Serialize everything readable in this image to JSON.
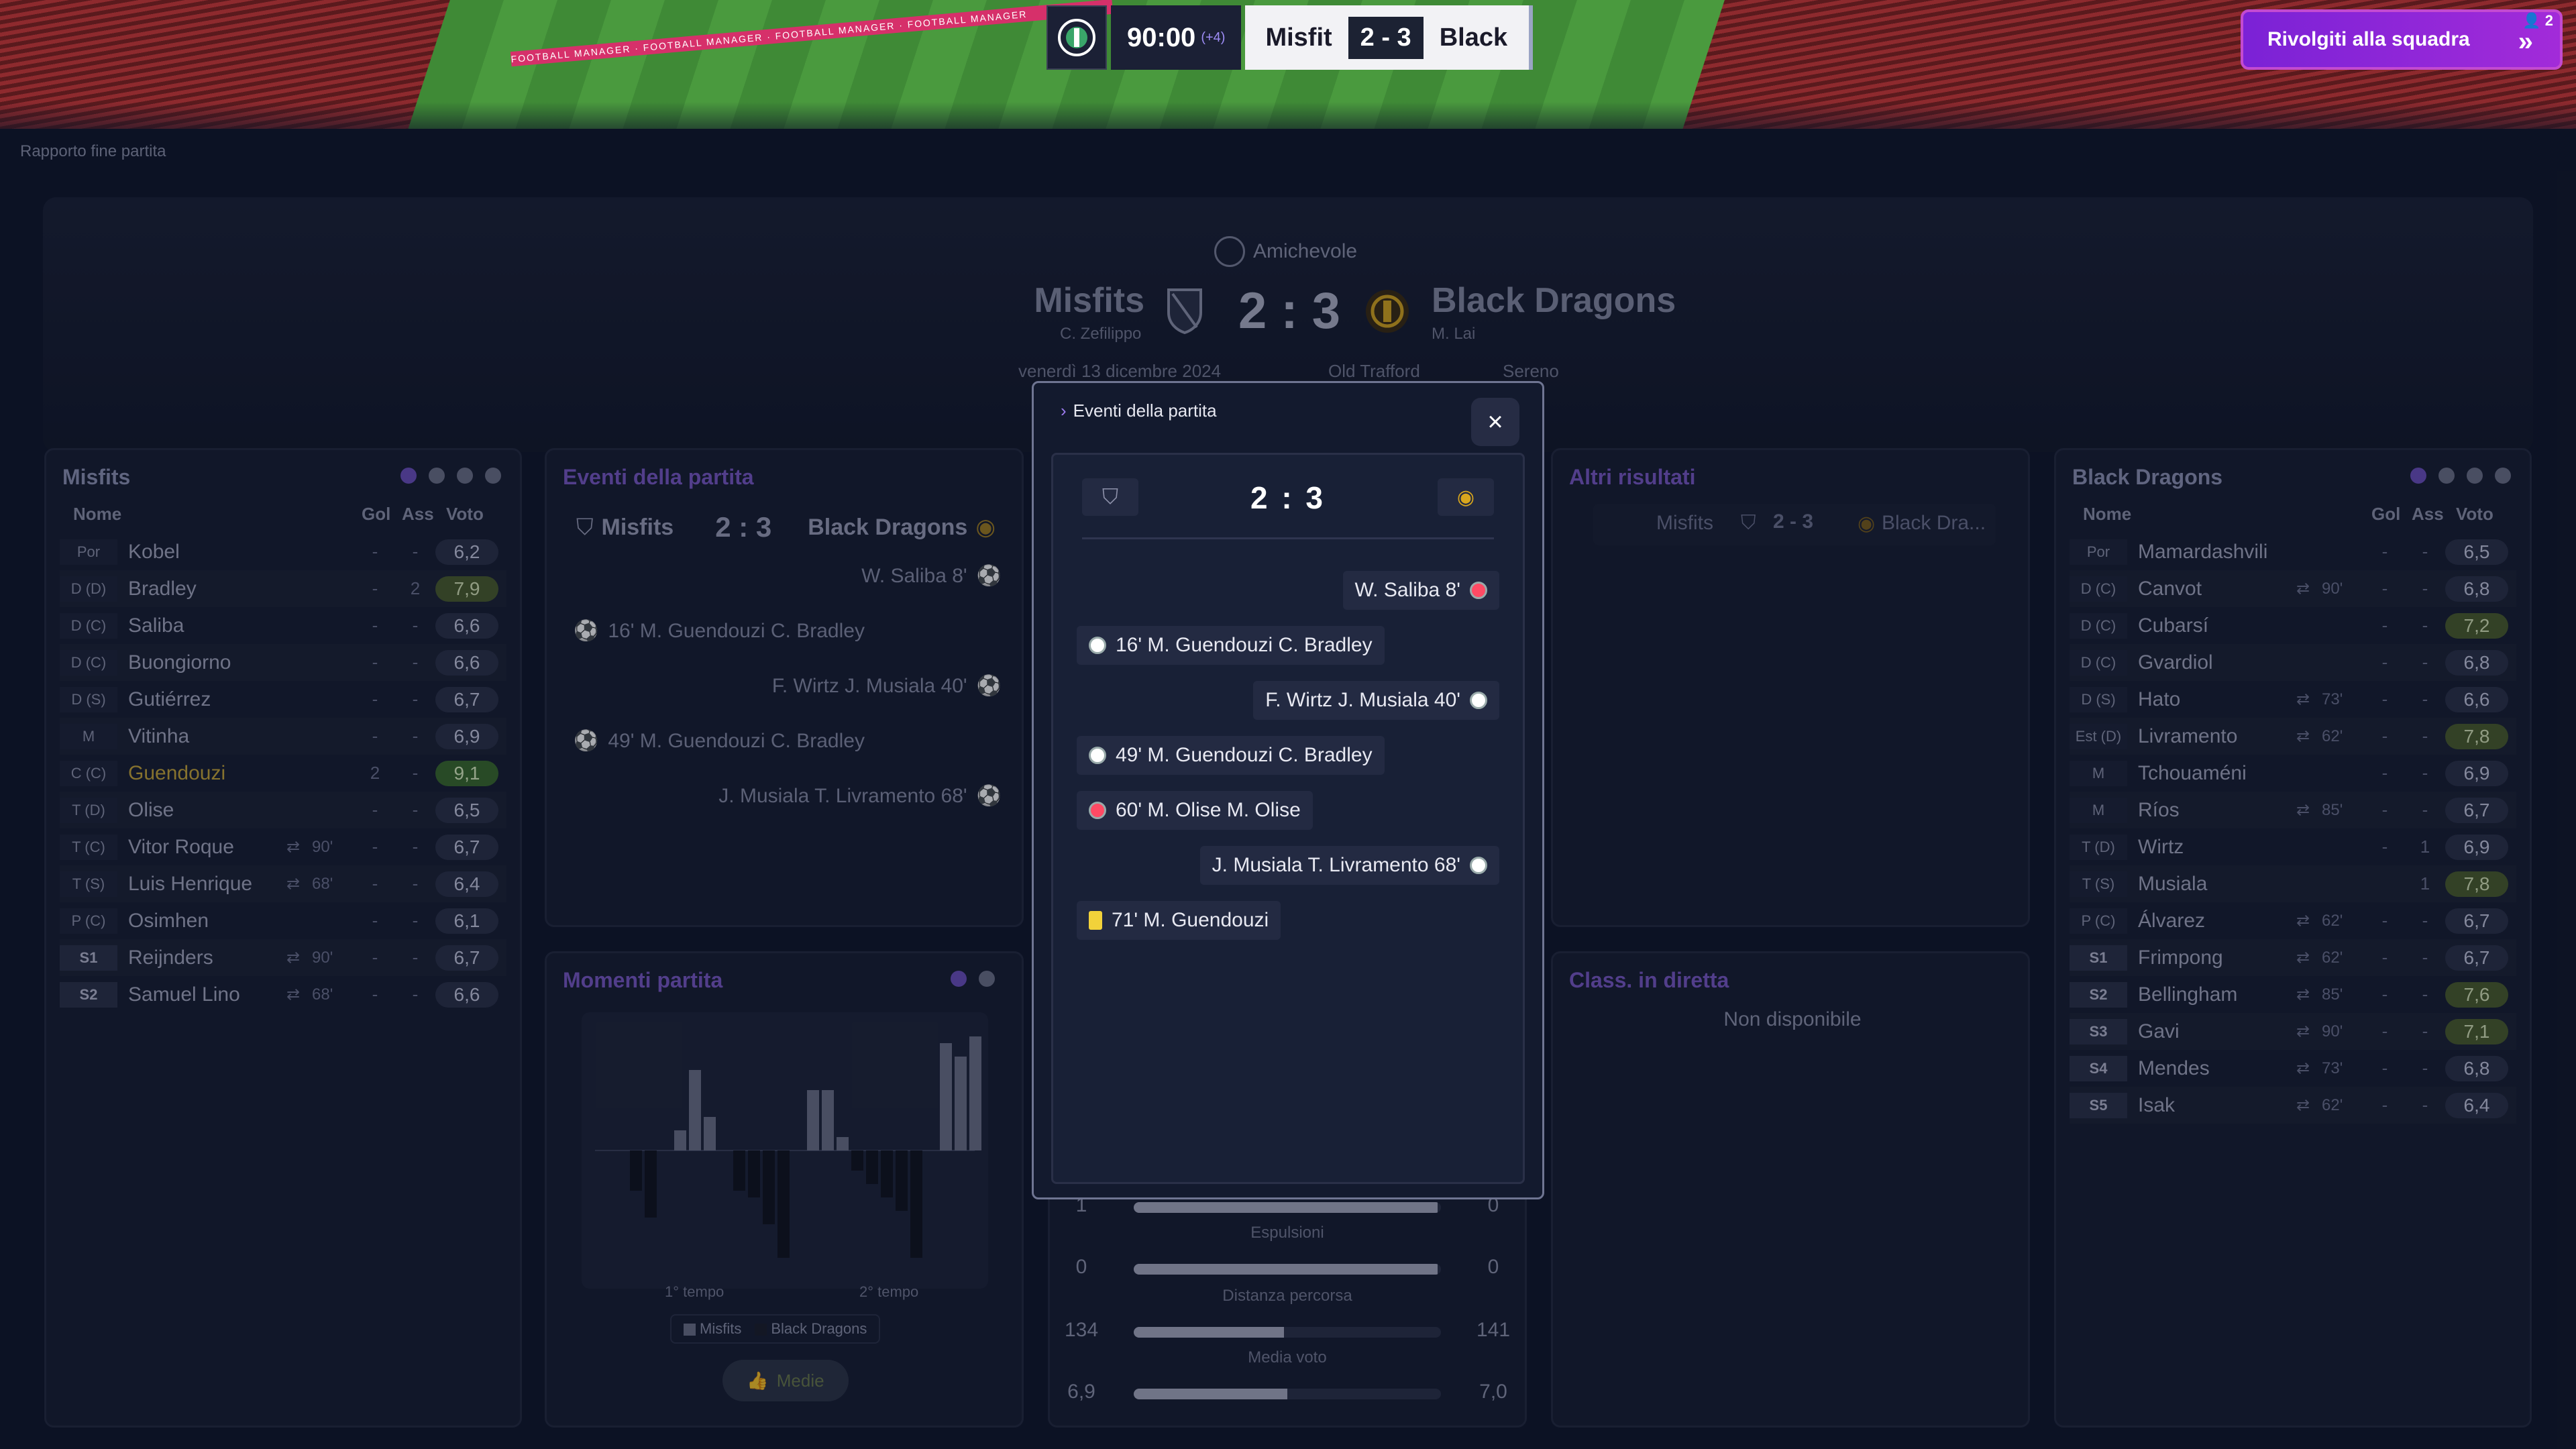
{
  "scorebar": {
    "time": "90:00",
    "added": "(+4)",
    "home": "Misfit",
    "score": "2 - 3",
    "away": "Black"
  },
  "team_button": {
    "label": "Rivolgiti alla squadra",
    "badge": "2"
  },
  "breadcrumb": "Rapporto fine partita",
  "header": {
    "competition": "Amichevole",
    "home": "Misfits",
    "home_manager": "C. Zefilippo",
    "score": "2 : 3",
    "away": "Black Dragons",
    "away_manager": "M. Lai",
    "date": "venerdì 13 dicembre 2024",
    "stadium": "Old Trafford",
    "weather": "Sereno"
  },
  "home_panel": {
    "title": "Misfits",
    "cols": {
      "name": "Nome",
      "gol": "Gol",
      "ass": "Ass",
      "voto": "Voto"
    },
    "players": [
      {
        "pos": "Por",
        "name": "Kobel",
        "sub": "",
        "gol": "-",
        "ass": "-",
        "voto": "6,2"
      },
      {
        "pos": "D (D)",
        "name": "Bradley",
        "sub": "",
        "gol": "-",
        "ass": "2",
        "voto": "7,9"
      },
      {
        "pos": "D (C)",
        "name": "Saliba",
        "sub": "",
        "gol": "-",
        "ass": "-",
        "voto": "6,6"
      },
      {
        "pos": "D (C)",
        "name": "Buongiorno",
        "sub": "",
        "gol": "-",
        "ass": "-",
        "voto": "6,6"
      },
      {
        "pos": "D (S)",
        "name": "Gutiérrez",
        "sub": "",
        "gol": "-",
        "ass": "-",
        "voto": "6,7"
      },
      {
        "pos": "M",
        "name": "Vitinha",
        "sub": "",
        "gol": "-",
        "ass": "-",
        "voto": "6,9"
      },
      {
        "pos": "C (C)",
        "name": "Guendouzi",
        "sub": "",
        "gol": "2",
        "ass": "-",
        "voto": "9,1"
      },
      {
        "pos": "T (D)",
        "name": "Olise",
        "sub": "",
        "gol": "-",
        "ass": "-",
        "voto": "6,5"
      },
      {
        "pos": "T (C)",
        "name": "Vitor Roque",
        "sub": "90'",
        "gol": "-",
        "ass": "-",
        "voto": "6,7"
      },
      {
        "pos": "T (S)",
        "name": "Luis Henrique",
        "sub": "68'",
        "gol": "-",
        "ass": "-",
        "voto": "6,4"
      },
      {
        "pos": "P (C)",
        "name": "Osimhen",
        "sub": "",
        "gol": "-",
        "ass": "-",
        "voto": "6,1"
      },
      {
        "pos": "S1",
        "name": "Reijnders",
        "sub": "90'",
        "gol": "-",
        "ass": "-",
        "voto": "6,7"
      },
      {
        "pos": "S2",
        "name": "Samuel Lino",
        "sub": "68'",
        "gol": "-",
        "ass": "-",
        "voto": "6,6"
      }
    ]
  },
  "away_panel": {
    "title": "Black Dragons",
    "cols": {
      "name": "Nome",
      "gol": "Gol",
      "ass": "Ass",
      "voto": "Voto"
    },
    "players": [
      {
        "pos": "Por",
        "name": "Mamardashvili",
        "sub": "",
        "gol": "-",
        "ass": "-",
        "voto": "6,5"
      },
      {
        "pos": "D (C)",
        "name": "Canvot",
        "sub": "90'",
        "gol": "-",
        "ass": "-",
        "voto": "6,8"
      },
      {
        "pos": "D (C)",
        "name": "Cubarsí",
        "sub": "",
        "gol": "-",
        "ass": "-",
        "voto": "7,2"
      },
      {
        "pos": "D (C)",
        "name": "Gvardiol",
        "sub": "",
        "gol": "-",
        "ass": "-",
        "voto": "6,8"
      },
      {
        "pos": "D (S)",
        "name": "Hato",
        "sub": "73'",
        "gol": "-",
        "ass": "-",
        "voto": "6,6"
      },
      {
        "pos": "Est (D)",
        "name": "Livramento",
        "sub": "62'",
        "gol": "-",
        "ass": "-",
        "voto": "7,8"
      },
      {
        "pos": "M",
        "name": "Tchouaméni",
        "sub": "",
        "gol": "-",
        "ass": "-",
        "voto": "6,9"
      },
      {
        "pos": "M",
        "name": "Ríos",
        "sub": "85'",
        "gol": "-",
        "ass": "-",
        "voto": "6,7"
      },
      {
        "pos": "T (D)",
        "name": "Wirtz",
        "sub": "",
        "gol": "-",
        "ass": "1",
        "voto": "6,9"
      },
      {
        "pos": "T (S)",
        "name": "Musiala",
        "sub": "",
        "gol": "",
        "ass": "1",
        "voto": "7,8"
      },
      {
        "pos": "P (C)",
        "name": "Álvarez",
        "sub": "62'",
        "gol": "-",
        "ass": "-",
        "voto": "6,7"
      },
      {
        "pos": "S1",
        "name": "Frimpong",
        "sub": "62'",
        "gol": "-",
        "ass": "-",
        "voto": "6,7"
      },
      {
        "pos": "S2",
        "name": "Bellingham",
        "sub": "85'",
        "gol": "-",
        "ass": "-",
        "voto": "7,6"
      },
      {
        "pos": "S3",
        "name": "Gavi",
        "sub": "90'",
        "gol": "-",
        "ass": "-",
        "voto": "7,1"
      },
      {
        "pos": "S4",
        "name": "Mendes",
        "sub": "73'",
        "gol": "-",
        "ass": "-",
        "voto": "6,8"
      },
      {
        "pos": "S5",
        "name": "Isak",
        "sub": "62'",
        "gol": "-",
        "ass": "-",
        "voto": "6,4"
      }
    ]
  },
  "events_panel": {
    "title": "Eventi della partita",
    "home": "Misfits",
    "score": "2 : 3",
    "away": "Black Dragons",
    "events": [
      "W. Saliba 8'",
      "16' M. Guendouzi C. Bradley",
      "F. Wirtz J. Musiala 40'",
      "49' M. Guendouzi C. Bradley",
      "J. Musiala T. Livramento 68'"
    ]
  },
  "moments_panel": {
    "title": "Momenti partita",
    "half1": "1° tempo",
    "half2": "2° tempo",
    "legend_home": "Misfits",
    "legend_away": "Black Dragons",
    "button": "Medie"
  },
  "altri_panel": {
    "title": "Altri risultati",
    "home": "Misfits",
    "score": "2 - 3",
    "away": "Black Dra..."
  },
  "class_panel": {
    "title": "Class. in diretta",
    "text": "Non disponibile"
  },
  "modal": {
    "title": "Eventi della partita",
    "close": "×",
    "score": "2 : 3",
    "events": [
      {
        "text": "W. Saliba 8'",
        "side": "right",
        "icon": "own-goal-ball-icon"
      },
      {
        "text": "16' M. Guendouzi C. Bradley",
        "side": "left",
        "icon": "ball-icon"
      },
      {
        "text": "F. Wirtz J. Musiala 40'",
        "side": "right",
        "icon": "ball-icon"
      },
      {
        "text": "49' M. Guendouzi C. Bradley",
        "side": "left",
        "icon": "ball-icon"
      },
      {
        "text": "60' M. Olise M. Olise",
        "side": "left",
        "icon": "injury-ball-icon"
      },
      {
        "text": "J. Musiala T. Livramento 68'",
        "side": "right",
        "icon": "ball-icon"
      },
      {
        "text": "71' M. Guendouzi",
        "side": "left",
        "icon": "yellow-card-icon"
      }
    ]
  },
  "stats": [
    {
      "label": "",
      "home": "1",
      "away": "0",
      "home_frac": 0.99
    },
    {
      "label": "Espulsioni",
      "home": "0",
      "away": "0",
      "home_frac": 0.99
    },
    {
      "label": "Distanza percorsa",
      "home": "134",
      "away": "141",
      "home_frac": 0.49
    },
    {
      "label": "Media voto",
      "home": "6,9",
      "away": "7,0",
      "home_frac": 0.5
    }
  ]
}
